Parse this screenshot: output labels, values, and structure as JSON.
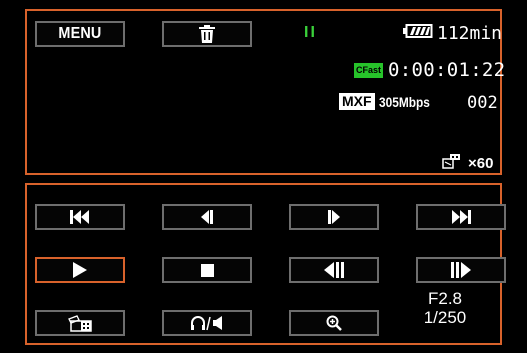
{
  "top_bar": {
    "menu_label": "MENU",
    "delete_icon": "trash-icon",
    "status_icon": "pause-indicator",
    "status_symbol": "II",
    "status_color": "#3ad13a",
    "battery_icon": "battery-icon",
    "remaining_time": "112min"
  },
  "recording_info": {
    "media_badge": "CFast",
    "media_badge_color": "#27c32a",
    "timecode": "0:00:01:22",
    "format_badge": "MXF",
    "bitrate": "305Mbps",
    "clip_number": "002"
  },
  "frame_rate": {
    "icon": "frame-rate-icon",
    "value": "×60"
  },
  "controls": {
    "row1": [
      {
        "name": "skip-to-start-button",
        "icon": "skip-to-start-icon"
      },
      {
        "name": "frame-back-button",
        "icon": "frame-back-icon"
      },
      {
        "name": "frame-forward-button",
        "icon": "frame-forward-icon"
      },
      {
        "name": "skip-to-end-button",
        "icon": "skip-to-end-icon"
      }
    ],
    "row2": [
      {
        "name": "play-button",
        "icon": "play-icon",
        "selected": true
      },
      {
        "name": "stop-button",
        "icon": "stop-icon"
      },
      {
        "name": "slow-reverse-button",
        "icon": "slow-reverse-icon"
      },
      {
        "name": "slow-forward-button",
        "icon": "slow-forward-icon"
      }
    ],
    "row3": [
      {
        "name": "clip-select-button",
        "icon": "film-clip-icon"
      },
      {
        "name": "audio-volume-button",
        "icon": "headphones-speaker-icon"
      },
      {
        "name": "zoom-button",
        "icon": "magnify-plus-icon"
      }
    ],
    "accent_color": "#d8622b"
  },
  "exposure": {
    "aperture": "F2.8",
    "shutter": "1/250"
  }
}
